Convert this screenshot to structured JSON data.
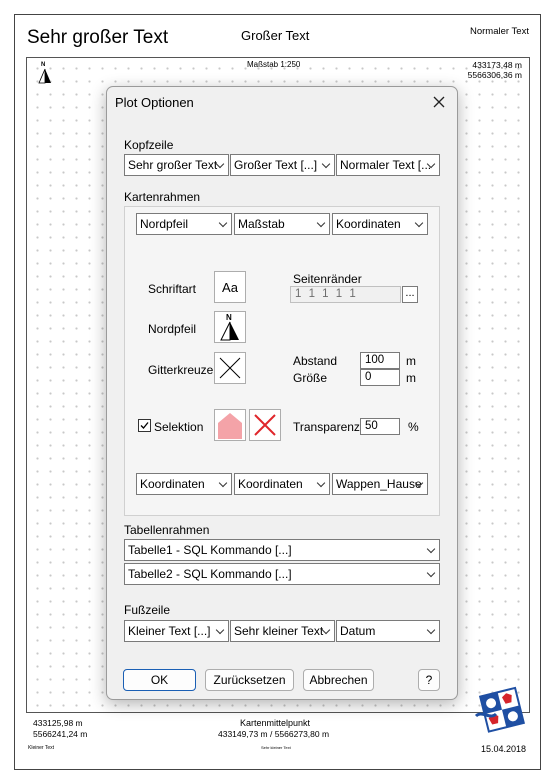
{
  "page": {
    "header_large": "Sehr großer Text",
    "header_medium": "Großer Text",
    "header_normal": "Normaler Text",
    "scale": "Maßstab 1:250",
    "coord_top_right_1": "433173,48 m",
    "coord_top_right_2": "5566306,36 m",
    "coord_bottom_left_1": "433125,98 m",
    "coord_bottom_left_2": "5566241,24 m",
    "center_label": "Kartenmittelpunkt",
    "center_coords": "433149,73 m / 5566273,80 m",
    "footer_small": "Kleiner Text",
    "footer_very_small": "Sehr kleiner Text",
    "date": "15.04.2018",
    "north_letter": "N"
  },
  "dialog": {
    "title": "Plot Optionen",
    "header_section": "Kopfzeile",
    "header_combos": [
      "Sehr großer Text",
      "Großer Text [...]",
      "Normaler Text [..."
    ],
    "map_frame_section": "Kartenrahmen",
    "frame_top_combos": [
      "Nordpfeil",
      "Maßstab",
      "Koordinaten"
    ],
    "font_label": "Schriftart",
    "font_button": "Aa",
    "margins_label": "Seitenränder",
    "margins_value": "1 1 1 1 1",
    "margins_button": "...",
    "north_label": "Nordpfeil",
    "north_letter": "N",
    "grid_label": "Gitterkreuze",
    "distance_label": "Abstand",
    "distance_value": "100",
    "distance_unit": "m",
    "size_label": "Größe",
    "size_value": "0",
    "size_unit": "m",
    "selection_label": "Selektion",
    "selection_checked": true,
    "selection_color": "#f4a3a8",
    "transparency_label": "Transparenz",
    "transparency_value": "50",
    "transparency_unit": "%",
    "frame_bottom_combos": [
      "Koordinaten",
      "Koordinaten",
      "Wappen_Hause"
    ],
    "table_section": "Tabellenrahmen",
    "table_combos": [
      "Tabelle1 - SQL Kommando [...]",
      "Tabelle2 - SQL Kommando [...]"
    ],
    "footer_section": "Fußzeile",
    "footer_combos": [
      "Kleiner Text [...]",
      "Sehr kleiner Text",
      "Datum"
    ],
    "ok": "OK",
    "reset": "Zurücksetzen",
    "cancel": "Abbrechen",
    "help": "?"
  },
  "colors": {
    "accent": "#1a5fb4",
    "delete": "#e0262b",
    "emblem_blue": "#1f4fa3",
    "emblem_red": "#d5242b"
  }
}
